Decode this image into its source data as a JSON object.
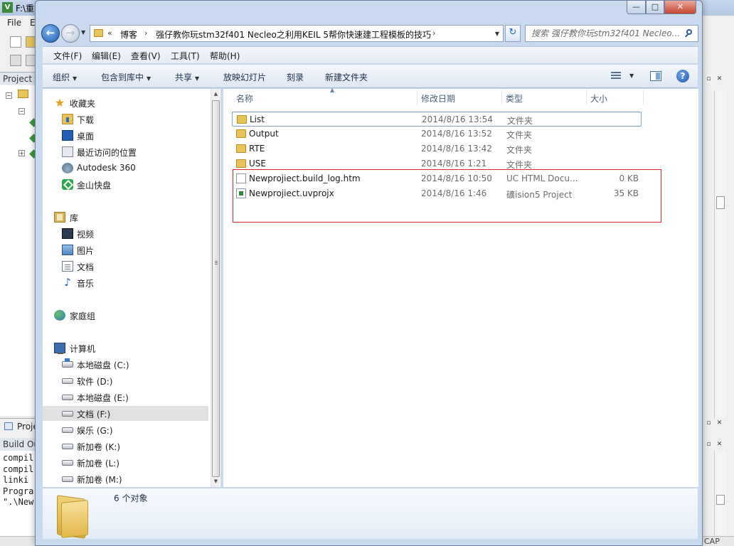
{
  "background_app": {
    "title": "F:\\重",
    "logo": "V",
    "menu": [
      "File",
      "E"
    ],
    "project_header": "Project",
    "tab_label": "Proje",
    "build_output_header": "Build Ou",
    "build_lines": [
      "compil",
      "compil",
      "linki",
      "Progra",
      "\".\\New"
    ],
    "statusbar_text": "CAP"
  },
  "window": {
    "caption_buttons": {
      "minimize": "—",
      "maximize": "□",
      "close": "✕"
    }
  },
  "address_bar": {
    "prefix": "«",
    "segments": [
      "博客",
      "强仔教你玩stm32f401 Necleo之利用KEIL 5帮你快速建工程模板的技巧"
    ],
    "separator": "›",
    "back_icon": "back-arrow-icon",
    "forward_icon": "forward-arrow-icon",
    "refresh_symbol": "↻"
  },
  "search": {
    "placeholder": "搜索 强仔教你玩stm32f401 Necleo..."
  },
  "menu": {
    "file": "文件(F)",
    "edit": "编辑(E)",
    "view": "查看(V)",
    "tools": "工具(T)",
    "help": "帮助(H)"
  },
  "commands": {
    "organize": "组织",
    "include_in_library": "包含到库中",
    "share": "共享",
    "slideshow": "放映幻灯片",
    "burn": "刻录",
    "new_folder": "新建文件夹",
    "help_symbol": "?"
  },
  "nav": {
    "favorites": {
      "label": "收藏夹",
      "items": [
        "下载",
        "桌面",
        "最近访问的位置",
        "Autodesk 360",
        "金山快盘"
      ]
    },
    "libraries": {
      "label": "库",
      "items": [
        "视频",
        "图片",
        "文档",
        "音乐"
      ]
    },
    "homegroup": "家庭组",
    "computer": {
      "label": "计算机",
      "drives": [
        "本地磁盘 (C:)",
        "软件 (D:)",
        "本地磁盘 (E:)",
        "文档 (F:)",
        "娱乐 (G:)",
        "新加卷 (K:)",
        "新加卷 (L:)",
        "新加卷 (M:)"
      ],
      "selected_drive": "文档 (F:)"
    }
  },
  "file_list": {
    "columns": {
      "name": "名称",
      "date": "修改日期",
      "type": "类型",
      "size": "大小"
    },
    "rows": [
      {
        "name": "List",
        "date": "2014/8/16 13:54",
        "type": "文件夹",
        "size": "",
        "icon": "folder-icon"
      },
      {
        "name": "Output",
        "date": "2014/8/16 13:52",
        "type": "文件夹",
        "size": "",
        "icon": "folder-icon"
      },
      {
        "name": "RTE",
        "date": "2014/8/16 13:42",
        "type": "文件夹",
        "size": "",
        "icon": "folder-icon"
      },
      {
        "name": "USE",
        "date": "2014/8/16 1:21",
        "type": "文件夹",
        "size": "",
        "icon": "folder-icon"
      },
      {
        "name": "Newprojiect.build_log.htm",
        "date": "2014/8/16 10:50",
        "type": "UC HTML Docu...",
        "size": "0 KB",
        "icon": "html-file-icon"
      },
      {
        "name": "Newprojiect.uvprojx",
        "date": "2014/8/16 1:46",
        "type": "礦ision5 Project",
        "size": "35 KB",
        "icon": "uvision-project-icon"
      }
    ],
    "highlight_color": "#d9262b"
  },
  "details": {
    "count": "6 个对象"
  }
}
